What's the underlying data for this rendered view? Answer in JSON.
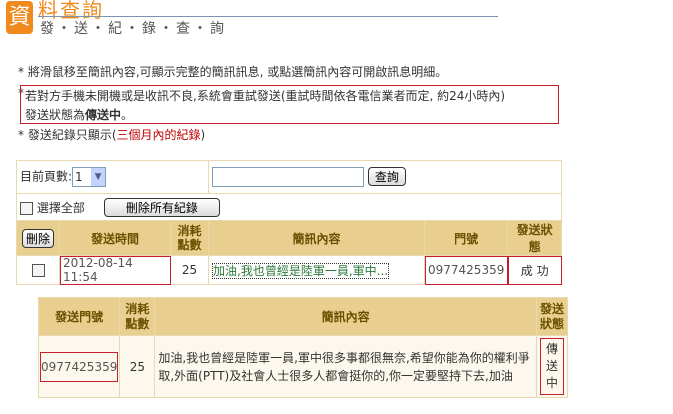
{
  "header": {
    "logo_char": "資",
    "title": "料查詢",
    "subtitle": "發・送・紀・錄・查・詢"
  },
  "notes": {
    "n1": "* 將滑鼠移至簡訊內容,可顯示完整的簡訊訊息, 或點選簡訊內容可開啟訊息明細。",
    "n2_star": "*",
    "n2": "若對方手機未開機或是收訊不良,系統會重試發送(重試時間依各電信業者而定, 約24小時內)",
    "n2b_pre": "發送狀態為",
    "n2b_bold": "傳送中",
    "n2b_post": "。",
    "n3_pre": "* 發送紀錄只顯示(",
    "n3_red": "三個月內的紀錄",
    "n3_post": ")"
  },
  "controls": {
    "page_label": "目前頁數:",
    "page_value": "1",
    "search_value": "",
    "search_button": "查詢",
    "select_all": "選擇全部",
    "delete_all": "刪除所有紀錄",
    "delete": "刪除"
  },
  "table": {
    "headers": [
      "發送時間",
      "消耗點數",
      "簡訊內容",
      "門號",
      "發送狀態"
    ],
    "row": {
      "time": "2012-08-14 11:54",
      "points": "25",
      "content": "加油,我也曾經是陸軍一員,軍中...",
      "number": "0977425359",
      "status": "成 功"
    }
  },
  "detail": {
    "headers": [
      "發送門號",
      "消耗點數",
      "簡訊內容",
      "發送狀態"
    ],
    "number": "0977425359",
    "points": "25",
    "content": "加油,我也曾經是陸軍一員,軍中很多事都很無奈,希望你能為你的權利爭取,外面(PTT)及社會人士很多人都會挺你的,你一定要堅持下去,加油",
    "status": "傳送中"
  }
}
